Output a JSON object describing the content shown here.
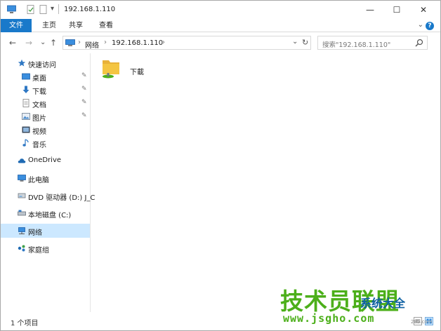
{
  "window": {
    "title": "192.168.1.110",
    "controls": {
      "minimize": "—",
      "maximize": "☐",
      "close": "✕"
    }
  },
  "quick_access_toolbar": {
    "dropdown": "▾"
  },
  "ribbon": {
    "tabs": [
      {
        "label": "文件"
      },
      {
        "label": "主页"
      },
      {
        "label": "共享"
      },
      {
        "label": "查看"
      }
    ],
    "expand": "⌄",
    "help": "?"
  },
  "address_bar": {
    "back": "←",
    "forward": "→",
    "recent": "⌄",
    "up": "↑",
    "separator": "›",
    "parts": [
      "网络",
      "192.168.1.110"
    ],
    "dropdown": "⌄",
    "refresh": "↻"
  },
  "search": {
    "placeholder": "搜索\"192.168.1.110\""
  },
  "nav_pane": {
    "pin": "✎",
    "items": [
      {
        "label": "快速访问",
        "icon": "star-icon"
      },
      {
        "label": "桌面",
        "icon": "desktop-icon",
        "pinned": true
      },
      {
        "label": "下载",
        "icon": "download-icon",
        "pinned": true
      },
      {
        "label": "文档",
        "icon": "document-icon",
        "pinned": true
      },
      {
        "label": "图片",
        "icon": "picture-icon",
        "pinned": true
      },
      {
        "label": "视频",
        "icon": "video-icon"
      },
      {
        "label": "音乐",
        "icon": "music-icon"
      },
      {
        "label": "OneDrive",
        "icon": "cloud-icon"
      },
      {
        "label": "此电脑",
        "icon": "computer-icon"
      },
      {
        "label": "DVD 驱动器 (D:) J_C",
        "icon": "dvd-icon"
      },
      {
        "label": "本地磁盘 (C:)",
        "icon": "drive-icon"
      },
      {
        "label": "网络",
        "icon": "network-icon",
        "selected": true
      },
      {
        "label": "家庭组",
        "icon": "homegroup-icon"
      }
    ]
  },
  "content": {
    "items": [
      {
        "label": "下載",
        "icon": "shared-folder-icon"
      }
    ]
  },
  "status_bar": {
    "count_text": "1 个项目"
  },
  "watermark": {
    "main": "技术员联盟",
    "sub": "系统大全",
    "url": "www.jsgho.com",
    "small": "285.com"
  },
  "colors": {
    "accent": "#1979ca",
    "selected_bg": "#cce8ff",
    "folder_yellow": "#f4c542",
    "watermark_green": "#4caf1a",
    "watermark_blue": "#0f61a3"
  }
}
